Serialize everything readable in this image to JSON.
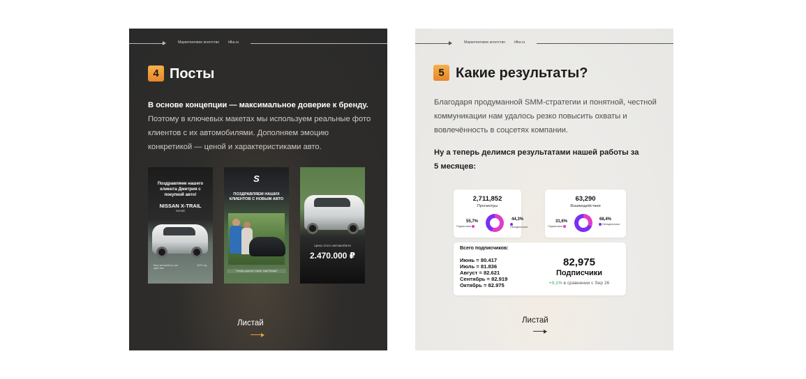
{
  "topbar": {
    "agency": "Маркетинговое агентство",
    "domain": "t4ka.ru"
  },
  "slide_posts": {
    "number": "4",
    "title": "Посты",
    "lead_strong": "В основе концепции — максимальное доверие к бренду.",
    "lead_rest": "Поэтому в ключевых макетах мы используем реальные фото клиентов с их автомобилями. Дополняем эмоцию конкретикой — ценой и характеристиками авто.",
    "posts": [
      {
        "headline": "Поздравляем нашего клиента Дмитрия с покупкой авто!",
        "model": "NISSAN X-TRAIL",
        "origin": "Китай",
        "footer_left": "Ваш автомобиль уже ждет вас",
        "footer_right": "2023 год"
      },
      {
        "logo": "S",
        "headline": "ПОЗДРАВЛЯЕМ НАШИХ КЛИЕНТОВ С НОВЫМ АВТО",
        "caption": "Теперь дороги станут ещё ближе!"
      },
      {
        "price_label": "Цена этого автомобиля",
        "price": "2.470.000 ₽"
      }
    ],
    "cta": "Листай"
  },
  "slide_results": {
    "number": "5",
    "title": "Какие результаты?",
    "intro": "Благодаря продуманной SMM-стратегии и понятной, честной коммуникации нам удалось резко повысить охваты и вовлечённость в соцсетях компании.",
    "sub": "Ну а теперь делимся результатами нашей работы за 5 месяцев:",
    "views_card": {
      "value": "2,711,852",
      "label": "Просмотры",
      "left_pct": "55,7%",
      "left_label": "Подписчики",
      "right_pct": "44,3%",
      "right_label": "Неподписчики"
    },
    "interactions_card": {
      "value": "63,290",
      "label": "Взаимодействия",
      "left_pct": "31,6%",
      "left_label": "Подписчики",
      "right_pct": "68,4%",
      "right_label": "Неподписчики"
    },
    "subs_card": {
      "title": "Всего подписчиков:",
      "rows": [
        "Июнь = 80.417",
        "Июль = 81.836",
        "Август = 82.621",
        "Сентябрь = 82.919",
        "Октябрь = 82.975"
      ],
      "total": "82,975",
      "total_label": "Подписчики",
      "growth_value": "+0,1%",
      "growth_rest": "в сравнении с Sep 26"
    },
    "cta": "Листай"
  },
  "colors": {
    "accent_orange": "#f0a03f",
    "donut_pink": "#e03cc8",
    "donut_purple": "#7b2ff2",
    "positive_green": "#2e9e52"
  },
  "donut_shares": {
    "views_subscribers_pct": 55.7,
    "interactions_subscribers_pct": 31.6
  }
}
